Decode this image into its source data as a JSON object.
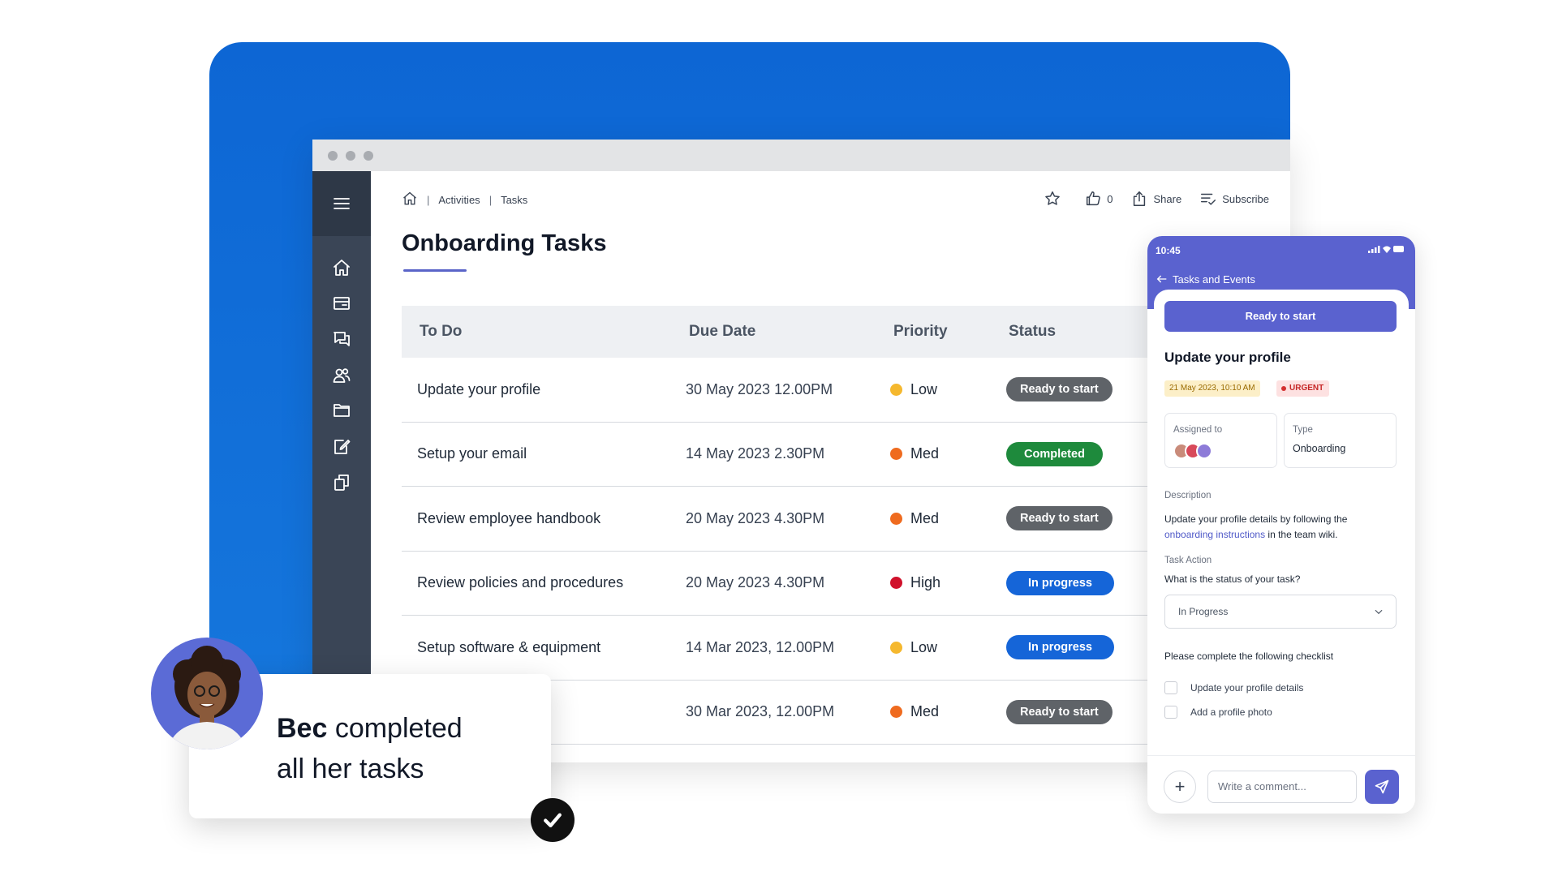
{
  "breadcrumb": {
    "home_icon": "home-icon",
    "items": [
      "Activities",
      "Tasks"
    ]
  },
  "header_actions": {
    "likes_count": "0",
    "share_label": "Share",
    "subscribe_label": "Subscribe"
  },
  "page": {
    "title": "Onboarding Tasks"
  },
  "table": {
    "headers": [
      "To Do",
      "Due Date",
      "Priority",
      "Status"
    ],
    "rows": [
      {
        "task": "Update your profile",
        "due": "30 May 2023 12.00PM",
        "priority": "Low",
        "status": "Ready to start"
      },
      {
        "task": "Setup your email",
        "due": "14 May 2023 2.30PM",
        "priority": "Med",
        "status": "Completed"
      },
      {
        "task": "Review employee handbook",
        "due": "20 May 2023 4.30PM",
        "priority": "Med",
        "status": "Ready to start"
      },
      {
        "task": "Review policies and procedures",
        "due": "20 May 2023 4.30PM",
        "priority": "High",
        "status": "In progress"
      },
      {
        "task": "Setup software & equipment",
        "due": "14 Mar 2023, 12.00PM",
        "priority": "Low",
        "status": "In progress"
      },
      {
        "task": "",
        "due": "30 Mar 2023, 12.00PM",
        "priority": "Med",
        "status": "Ready to start"
      }
    ]
  },
  "colors": {
    "backdrop": "#0d66d4",
    "sidebar": "#3a4556",
    "accent": "#5a62cf",
    "priority_low": "#f5b82e",
    "priority_med": "#ef6b1f",
    "priority_high": "#d0112b",
    "status_ready": "#5f6368",
    "status_completed": "#1e8a3c",
    "status_in_progress": "#1565d8"
  },
  "sidebar": {
    "icons": [
      "menu-icon",
      "home-icon",
      "news-icon",
      "chat-icon",
      "people-icon",
      "folder-icon",
      "edit-icon",
      "copy-icon"
    ]
  },
  "mobile": {
    "time": "10:45",
    "back_label": "Tasks and Events",
    "primary_button": "Ready to start",
    "task_title": "Update your profile",
    "date_badge": "21 May 2023, 10:10 AM",
    "urgent_badge": "URGENT",
    "assigned_label": "Assigned to",
    "type_label": "Type",
    "type_value": "Onboarding",
    "description_label": "Description",
    "description_pre": "Update your profile details by following the ",
    "description_link": "onboarding instructions",
    "description_post": " in the team wiki.",
    "task_action_label": "Task Action",
    "task_action_question": "What is the status of your task?",
    "select_value": "In Progress",
    "checklist_prompt": "Please complete the following checklist",
    "checklist": [
      "Update your profile details",
      "Add a profile photo"
    ],
    "comment_placeholder": "Write a comment..."
  },
  "notification": {
    "name": "Bec",
    "text_line1": "completed",
    "text_line2": "all her tasks"
  }
}
